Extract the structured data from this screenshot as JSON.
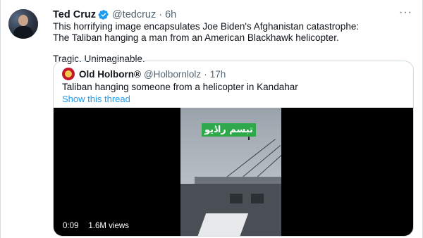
{
  "tweet": {
    "author_name": "Ted Cruz",
    "author_handle": "@tedcruz",
    "time": "6h",
    "text_line1": "This horrifying image encapsulates Joe Biden's Afghanistan catastrophe:",
    "text_line2": "The Taliban hanging a man from an American Blackhawk helicopter.",
    "text_line3": "Tragic. Unimaginable.",
    "more_icon": "more-dots-icon",
    "verified_icon": "verified-badge-icon",
    "verified_color": "#1d9bf0"
  },
  "quoted": {
    "author_name": "Old Holborn®",
    "author_handle": "@Holbornlolz",
    "time": "17h",
    "text": "Taliban hanging someone from a helicopter in Kandahar",
    "show_thread": "Show this thread",
    "link_color": "#1d9bf0",
    "video": {
      "overlay_text": "تبسم راڈیو",
      "duration": "0:09",
      "views": "1.6M views"
    }
  }
}
